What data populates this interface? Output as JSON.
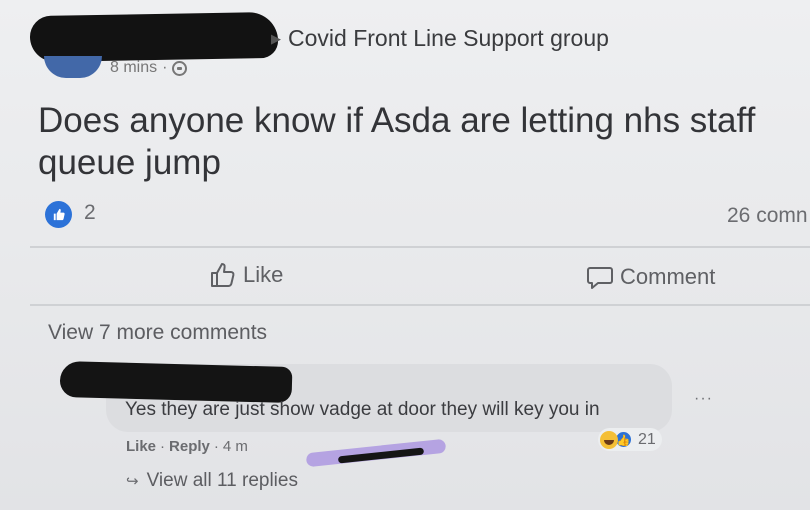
{
  "post": {
    "group_name": "Covid Front Line Support group",
    "group_arrow": "▶",
    "time": "8 mins",
    "time_sep": "·",
    "text": "Does anyone know if Asda are letting nhs staff queue jump",
    "reaction_count": "2",
    "comment_count": "26 comn"
  },
  "actions": {
    "like_label": "Like",
    "comment_label": "Comment"
  },
  "comments": {
    "view_more": "View 7 more comments",
    "comment_text": "Yes they are just show vadge at door they will key you in",
    "more_dots": "···",
    "reaction_count": "21",
    "like_label": "Like",
    "sep1": "·",
    "reply_label": "Reply",
    "sep2": "·",
    "time": "4 m",
    "view_replies": "View all 11 replies",
    "reply_arrow": "↪"
  },
  "colors": {
    "like_blue": "#2c72d8",
    "haha_yellow": "#f4bf36",
    "scribble_purple": "#b5a3e2"
  }
}
